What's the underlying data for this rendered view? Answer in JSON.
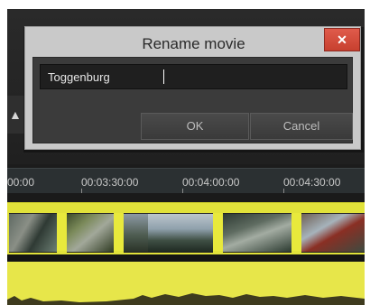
{
  "dialog": {
    "title": "Rename movie",
    "close_glyph": "✕",
    "input_value": "Toggenburg",
    "ok_label": "OK",
    "cancel_label": "Cancel"
  },
  "timeline": {
    "ticks": [
      "00:00",
      "00:03:30:00",
      "00:04:00:00",
      "00:04:30:00"
    ],
    "clip_track_color": "#e1e23a",
    "audio_track_color": "#e7e64a"
  },
  "icons": {
    "close": "close-icon"
  }
}
